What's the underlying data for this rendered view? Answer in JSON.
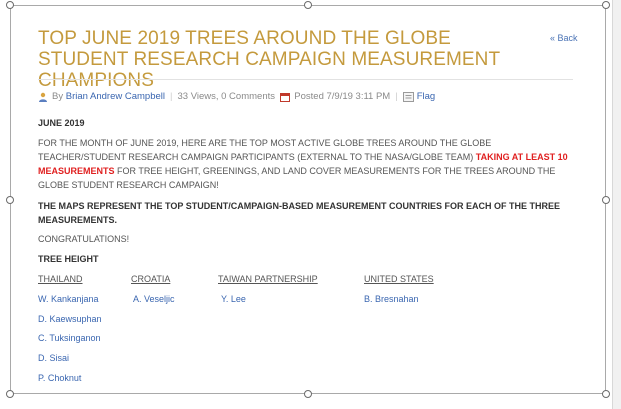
{
  "post": {
    "title": "TOP JUNE 2019 TREES AROUND THE GLOBE STUDENT RESEARCH CAMPAIGN MEASUREMENT CHAMPIONS",
    "back_label": "« Back",
    "meta": {
      "by_label": "By",
      "author": "Brian Andrew Campbell",
      "views_comments": "33 Views, 0 Comments",
      "posted": "Posted 7/9/19 3:11 PM",
      "flag_label": "Flag"
    },
    "month_heading": "JUNE 2019",
    "para_before": "FOR THE MONTH OF JUNE 2019, HERE ARE THE TOP MOST ACTIVE GLOBE TREES AROUND THE GLOBE TEACHER/STUDENT RESEARCH CAMPAIGN PARTICIPANTS (EXTERNAL TO THE NASA/GLOBE TEAM) ",
    "para_highlight": "TAKING AT LEAST 10 MEASUREMENTS",
    "para_after": " FOR TREE HEIGHT, GREENINGS, AND LAND COVER MEASUREMENTS FOR THE TREES AROUND THE GLOBE STUDENT RESEARCH CAMPAIGN!",
    "maps_note": "THE MAPS REPRESENT THE TOP STUDENT/CAMPAIGN-BASED MEASUREMENT COUNTRIES FOR EACH OF THE THREE MEASUREMENTS.",
    "congrats": "CONGRATULATIONS!",
    "section_heading": "TREE HEIGHT",
    "countries": [
      "THAILAND",
      "CROATIA",
      "TAIWAN PARTNERSHIP",
      "UNITED STATES"
    ],
    "thailand": [
      "W. Kankanjana",
      "D. Kaewsuphan",
      "C. Tuksinganon",
      "D. Sisai",
      "P. Choknut"
    ],
    "croatia": [
      "A. Veseljic"
    ],
    "taiwan": [
      "Y. Lee"
    ],
    "united_states": [
      "B. Bresnahan"
    ]
  },
  "colors": {
    "title": "#c49a3d",
    "link": "#3a66b0",
    "highlight": "#e02020"
  }
}
